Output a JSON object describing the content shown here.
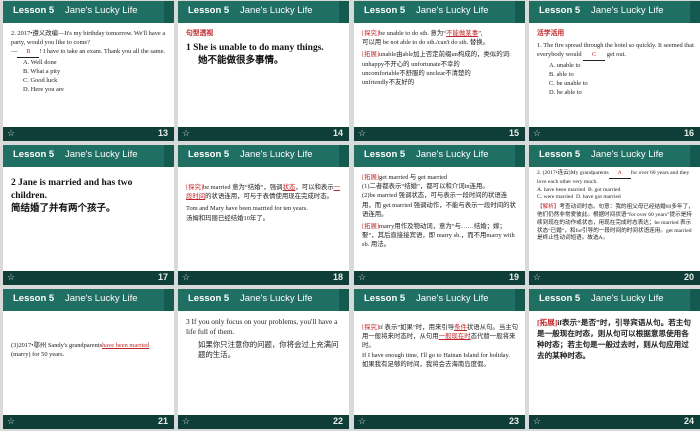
{
  "header": {
    "lesson": "Lesson 5",
    "title": "Jane's Lucky Life"
  },
  "footer": {
    "star": "☆"
  },
  "slides": [
    {
      "num": "13",
      "l1": "2. 2017•遵义改编—It's my birthday tomorrow. We'll have a party, would you like to come?",
      "ans": "B",
      "l2a": "—",
      "l2b": "! I have to take an exam. Thank you all the same.",
      "a": "A. Well done",
      "b": "B. What a pity",
      "c": "C. Good luck",
      "d": "D. Here you are"
    },
    {
      "num": "14",
      "tag": "句型透视",
      "l1": "1  She is unable to do many things.",
      "l2": "她不能做很多事情。"
    },
    {
      "num": "15",
      "t1": "[探究]",
      "l1a": "be unable to do sth. 意为“",
      "ans": "不能做某事",
      "l1b": "”,",
      "l2": "可以用 be not able to do sth./can't do sth. 替换。",
      "t2": "[拓展]",
      "l3": "unable由able加上否定前缀un构成的，类似的词:",
      "l4": "unhappy不开心的  unfortunate不幸的",
      "l5": "uncomfortable不舒服的  unclear不清楚的",
      "l6": "unfriendly不友好的"
    },
    {
      "num": "16",
      "tag": "活学活用",
      "l1": "1. The fire spread through the hotel so quickly. It seemed that everybody would",
      "ans": "C",
      "l1b": "get out.",
      "a": "A. unable to",
      "b": "B. able to",
      "c": "C. be unable to",
      "d": "D. be able to"
    },
    {
      "num": "17",
      "l1": "2  Jane is married and has two children.",
      "l2": "简结婚了并有两个孩子。"
    },
    {
      "num": "18",
      "t1": "[探究]",
      "l1a": "be married 意为“结婚”，强调",
      "ans1": "状态",
      "l1b": "，可以和表示",
      "ans2": "一段时间",
      "l1c": "的状语连用，可与于表情使用现在完成时态。",
      "l2": "Tom and Mary have been married for ten years.",
      "l3": "汤姆和玛丽已经结婚10年了。"
    },
    {
      "num": "19",
      "t1": "[拓展]",
      "l1": "get married 与 get married",
      "l2": "(1)二者都表示“结婚”，都可以和介词in连用。",
      "l3": "(2)be married 强调状态，可与表示一段时间的状语连用，而 get married 强调动作，不能与表示一段时间的状语连用。",
      "t2": "[拓展]",
      "l4": "marry用作及物动词，意为“与……结婚；嫁；娶”，其后直接接宾语，即 marry sb.，而不用marry with sb. 用法。"
    },
    {
      "num": "20",
      "l1a": "2. (2017•连云)My grandparents",
      "ans": "A",
      "l1b": "for over 60 years and they love each other very much.",
      "a": "A. have been married",
      "b": "B. got married",
      "c": "C. were married",
      "d": "D. have got married",
      "t1": "【解析】",
      "l2": "考查动词时态。句意：我的祖父母已经结婚60多年了，他们仍然非常爱彼此。根据时间状语“for over 60 years”提示是持续到现在的动作或状态，用现在完成时态表达；be married 表示状态“已婚”，和for引导的一段时间的时间状语连用。get married是终止性动词短语。故选A。"
    },
    {
      "num": "21",
      "l1": "(3)2017•鄂州 Sandy's grandparents",
      "ans": "have been married",
      "l2": "(marry) for 50 years."
    },
    {
      "num": "22",
      "l1": "3  If you only focus on your problems, you'll have a life full of them.",
      "l2": "如果你只注意你的问题，你将会过上充满问题的生活。"
    },
    {
      "num": "23",
      "t1": "[探究]",
      "l1a": "if 表示“如果”时，用来引导",
      "ans1": "条件",
      "l1b": "状语从句。当主句用一般将来时态时，从句用",
      "ans2": "一般现在时",
      "l1c": "态代替一般将来时。",
      "l2": "If I have enough time, I'll go to Hainan Island for holiday.",
      "l3": "如果我有足够的时间，我将会去海南岛度假。"
    },
    {
      "num": "24",
      "t1": "[拓展]",
      "l1": "if表示“是否”时，引导宾语从句。若主句是一般现在时态，则从句可以根据意思使用各种时态；若主句是一般过去时，则从句应用过去的某种时态。"
    }
  ]
}
